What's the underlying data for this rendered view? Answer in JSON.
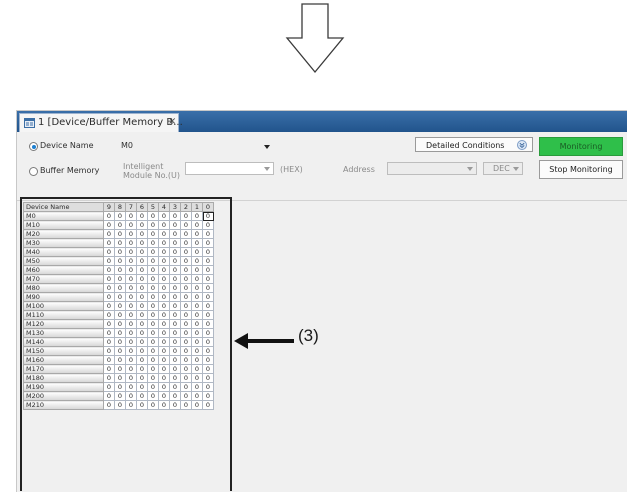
{
  "tab": {
    "title": "1 [Device/Buffer Memory B...",
    "close": "×"
  },
  "toolbar": {
    "device_name_label": "Device Name",
    "device_name_value": "M0",
    "buffer_memory_label": "Buffer Memory",
    "intelligent_module_label_line1": "Intelligent",
    "intelligent_module_label_line2": "Module No.(U)",
    "hex_label": "(HEX)",
    "address_label": "Address",
    "dec_value": "DEC",
    "detailed_conditions_label": "Detailed Conditions",
    "monitoring_label": "Monitoring",
    "stop_monitoring_label": "Stop Monitoring"
  },
  "grid": {
    "header_name": "Device Name",
    "bit_columns": [
      "9",
      "8",
      "7",
      "6",
      "5",
      "4",
      "3",
      "2",
      "1",
      "0"
    ],
    "rows": [
      {
        "name": "M0",
        "values": [
          "0",
          "0",
          "0",
          "0",
          "0",
          "0",
          "0",
          "0",
          "0",
          "0"
        ]
      },
      {
        "name": "M10",
        "values": [
          "0",
          "0",
          "0",
          "0",
          "0",
          "0",
          "0",
          "0",
          "0",
          "0"
        ]
      },
      {
        "name": "M20",
        "values": [
          "0",
          "0",
          "0",
          "0",
          "0",
          "0",
          "0",
          "0",
          "0",
          "0"
        ]
      },
      {
        "name": "M30",
        "values": [
          "0",
          "0",
          "0",
          "0",
          "0",
          "0",
          "0",
          "0",
          "0",
          "0"
        ]
      },
      {
        "name": "M40",
        "values": [
          "0",
          "0",
          "0",
          "0",
          "0",
          "0",
          "0",
          "0",
          "0",
          "0"
        ]
      },
      {
        "name": "M50",
        "values": [
          "0",
          "0",
          "0",
          "0",
          "0",
          "0",
          "0",
          "0",
          "0",
          "0"
        ]
      },
      {
        "name": "M60",
        "values": [
          "0",
          "0",
          "0",
          "0",
          "0",
          "0",
          "0",
          "0",
          "0",
          "0"
        ]
      },
      {
        "name": "M70",
        "values": [
          "0",
          "0",
          "0",
          "0",
          "0",
          "0",
          "0",
          "0",
          "0",
          "0"
        ]
      },
      {
        "name": "M80",
        "values": [
          "0",
          "0",
          "0",
          "0",
          "0",
          "0",
          "0",
          "0",
          "0",
          "0"
        ]
      },
      {
        "name": "M90",
        "values": [
          "0",
          "0",
          "0",
          "0",
          "0",
          "0",
          "0",
          "0",
          "0",
          "0"
        ]
      },
      {
        "name": "M100",
        "values": [
          "0",
          "0",
          "0",
          "0",
          "0",
          "0",
          "0",
          "0",
          "0",
          "0"
        ]
      },
      {
        "name": "M110",
        "values": [
          "0",
          "0",
          "0",
          "0",
          "0",
          "0",
          "0",
          "0",
          "0",
          "0"
        ]
      },
      {
        "name": "M120",
        "values": [
          "0",
          "0",
          "0",
          "0",
          "0",
          "0",
          "0",
          "0",
          "0",
          "0"
        ]
      },
      {
        "name": "M130",
        "values": [
          "0",
          "0",
          "0",
          "0",
          "0",
          "0",
          "0",
          "0",
          "0",
          "0"
        ]
      },
      {
        "name": "M140",
        "values": [
          "0",
          "0",
          "0",
          "0",
          "0",
          "0",
          "0",
          "0",
          "0",
          "0"
        ]
      },
      {
        "name": "M150",
        "values": [
          "0",
          "0",
          "0",
          "0",
          "0",
          "0",
          "0",
          "0",
          "0",
          "0"
        ]
      },
      {
        "name": "M160",
        "values": [
          "0",
          "0",
          "0",
          "0",
          "0",
          "0",
          "0",
          "0",
          "0",
          "0"
        ]
      },
      {
        "name": "M170",
        "values": [
          "0",
          "0",
          "0",
          "0",
          "0",
          "0",
          "0",
          "0",
          "0",
          "0"
        ]
      },
      {
        "name": "M180",
        "values": [
          "0",
          "0",
          "0",
          "0",
          "0",
          "0",
          "0",
          "0",
          "0",
          "0"
        ]
      },
      {
        "name": "M190",
        "values": [
          "0",
          "0",
          "0",
          "0",
          "0",
          "0",
          "0",
          "0",
          "0",
          "0"
        ]
      },
      {
        "name": "M200",
        "values": [
          "0",
          "0",
          "0",
          "0",
          "0",
          "0",
          "0",
          "0",
          "0",
          "0"
        ]
      },
      {
        "name": "M210",
        "values": [
          "0",
          "0",
          "0",
          "0",
          "0",
          "0",
          "0",
          "0",
          "0",
          "0"
        ]
      }
    ]
  },
  "annotation": {
    "label": "(3)"
  },
  "colors": {
    "tabstrip": "#2a5f98",
    "monitoring_button": "#2fbf4a",
    "radio_selected": "#1d7fd0"
  },
  "icons": {
    "down_arrow": "down-arrow-icon",
    "tab": "window-tab-icon",
    "callout": "left-arrow-icon"
  }
}
